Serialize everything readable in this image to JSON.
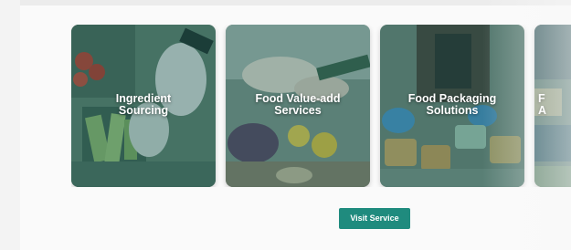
{
  "services": {
    "cards": [
      {
        "title": "Ingredient\nSourcing"
      },
      {
        "title": "Food Value-add\nServices"
      },
      {
        "title": "Food Packaging\nSolutions"
      },
      {
        "title": "F\nA"
      }
    ],
    "button_label": "Visit Service"
  },
  "colors": {
    "accent": "#1f8b7e",
    "overlay": "#16645a",
    "background": "#f3f3f3"
  }
}
